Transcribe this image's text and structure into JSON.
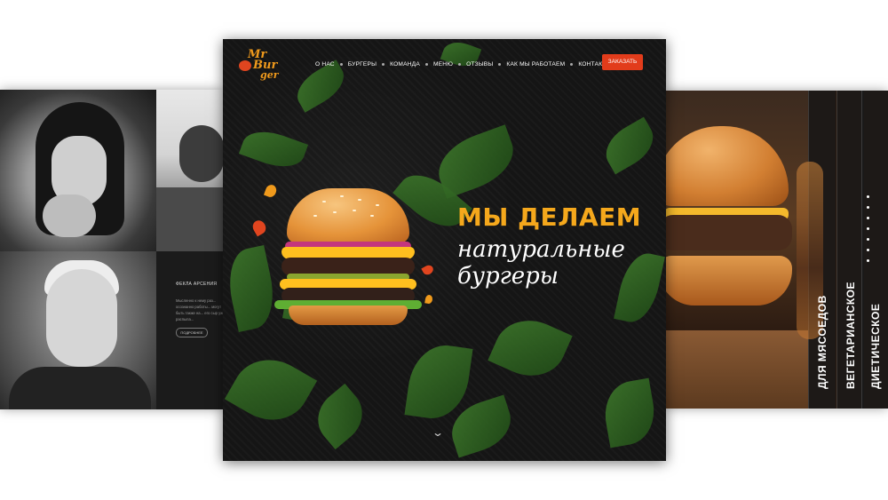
{
  "left_panel": {
    "member_name": "ФЕКЛА АРСЕНИЯ",
    "member_text": "Мысленно к нему раз... осознанно работы... могут быть также на... его сыр уже распыла...",
    "more_button": "ПОДРОБНЕЕ"
  },
  "header": {
    "logo": {
      "line1": "Mr",
      "line2": "Bur",
      "line3": "ger"
    },
    "nav": [
      "О НАС",
      "БУРГЕРЫ",
      "КОМАНДА",
      "МЕНЮ",
      "ОТЗЫВЫ",
      "КАК МЫ РАБОТАЕМ",
      "КОНТАКТЫ"
    ],
    "order_button": "ЗАКАЗАТЬ"
  },
  "hero": {
    "title": "МЫ ДЕЛАЕМ",
    "subtitle": "натуральные бургеры",
    "scroll_icon": "chevron-down-icon"
  },
  "categories": [
    "ДЛЯ МЯСОЕДОВ",
    "ВЕГЕТАРИАНСКОЕ",
    "ДИЕТИЧЕСКОЕ"
  ],
  "colors": {
    "accent": "#e23c1b",
    "brand_orange": "#f5a81c",
    "background": "#151515"
  }
}
